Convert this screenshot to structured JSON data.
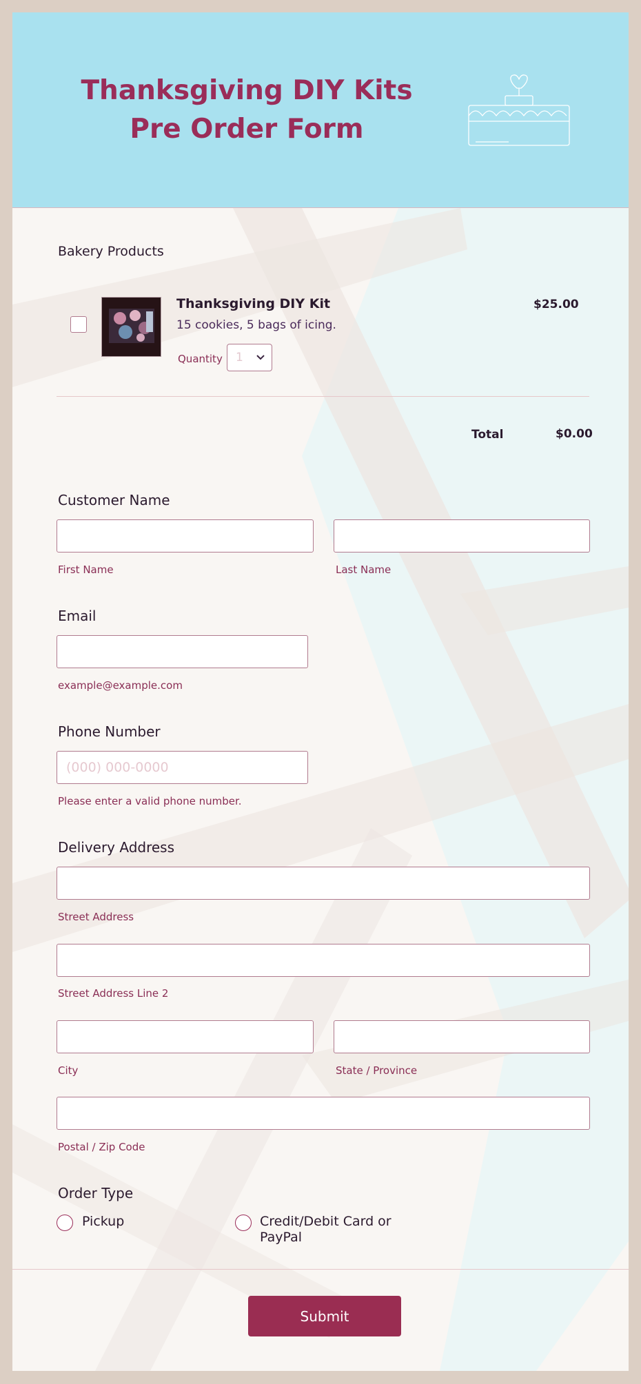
{
  "header": {
    "title": "Thanksgiving DIY Kits Pre Order Form"
  },
  "products": {
    "section_label": "Bakery Products",
    "items": [
      {
        "name": "Thanksgiving DIY Kit",
        "description": "15 cookies, 5 bags of icing.",
        "price": "$25.00",
        "quantity_label": "Quantity",
        "quantity_value": "1",
        "checked": false
      }
    ],
    "total_label": "Total",
    "total_value": "$0.00"
  },
  "customer_name": {
    "label": "Customer Name",
    "first_sublabel": "First Name",
    "last_sublabel": "Last Name"
  },
  "email": {
    "label": "Email",
    "sublabel": "example@example.com"
  },
  "phone": {
    "label": "Phone Number",
    "placeholder": "(000) 000-0000",
    "sublabel": "Please enter a valid phone number."
  },
  "address": {
    "label": "Delivery Address",
    "street_sublabel": "Street Address",
    "street2_sublabel": "Street Address Line 2",
    "city_sublabel": "City",
    "state_sublabel": "State / Province",
    "postal_sublabel": "Postal / Zip Code"
  },
  "order_type": {
    "label": "Order Type",
    "options": [
      "Pickup",
      "Credit/Debit Card or PayPal"
    ]
  },
  "submit": {
    "label": "Submit"
  },
  "colors": {
    "header_bg": "#a9e1ef",
    "accent": "#9a2d59",
    "page_bg": "#dccfc4",
    "field_border": "#b07a8e"
  }
}
